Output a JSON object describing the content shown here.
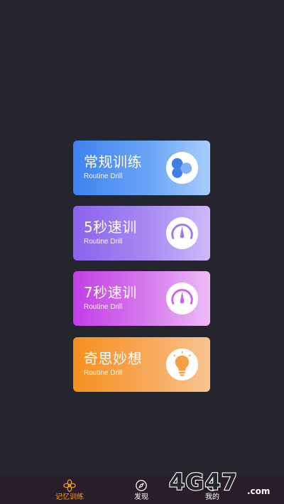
{
  "colors": {
    "background": "#25252d",
    "tab_active": "#f39a2c",
    "tab_inactive": "#ffffff"
  },
  "cards": [
    {
      "title": "常规训练",
      "subtitle": "Routine Drill",
      "icon": "bubbles-icon"
    },
    {
      "title": "5秒速训",
      "subtitle": "Routine Drill",
      "icon": "speedometer-icon"
    },
    {
      "title": "7秒速训",
      "subtitle": "Routine Drill",
      "icon": "speedometer-icon"
    },
    {
      "title": "奇思妙想",
      "subtitle": "Routine Drill",
      "icon": "lightbulb-icon"
    }
  ],
  "tabbar": {
    "items": [
      {
        "label": "记忆训练",
        "icon": "flower-icon",
        "active": true
      },
      {
        "label": "发现",
        "icon": "compass-icon",
        "active": false
      },
      {
        "label": "我的",
        "icon": "chat-icon",
        "active": false
      }
    ]
  },
  "watermark": {
    "text": "4G47.com"
  }
}
